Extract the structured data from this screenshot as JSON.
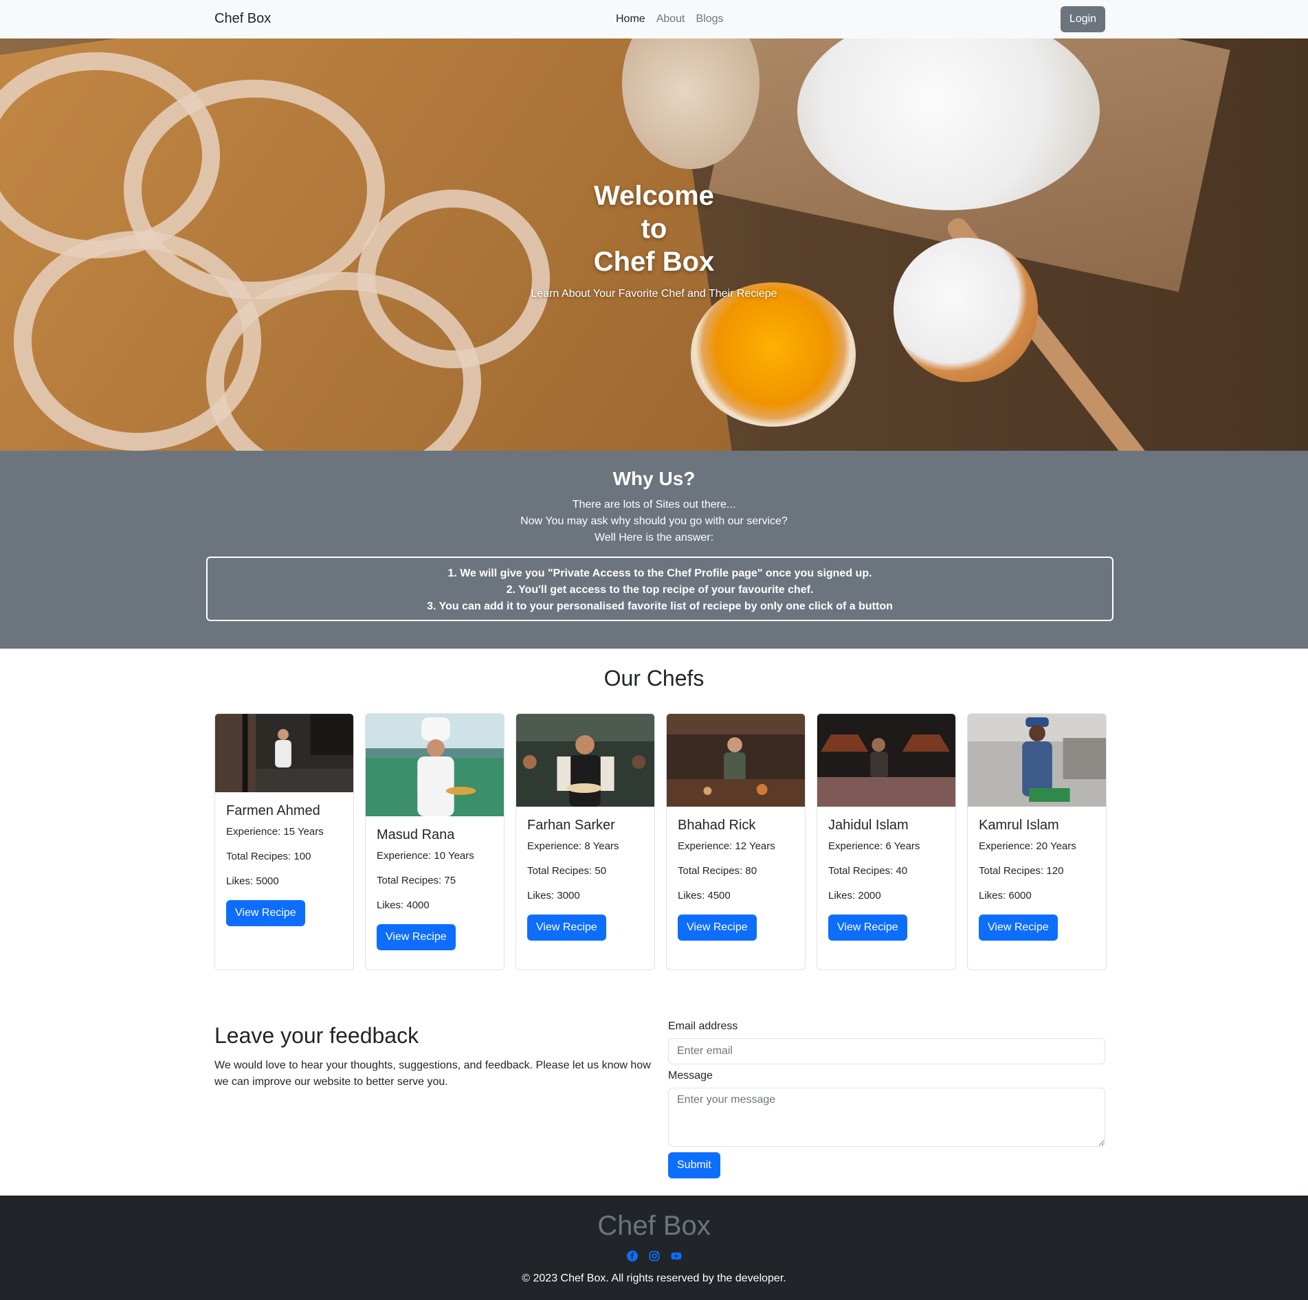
{
  "nav": {
    "brand": "Chef Box",
    "links": [
      {
        "label": "Home",
        "active": true
      },
      {
        "label": "About",
        "active": false
      },
      {
        "label": "Blogs",
        "active": false
      }
    ],
    "login_label": "Login"
  },
  "hero": {
    "title_line1": "Welcome",
    "title_line2": "to",
    "title_line3": "Chef Box",
    "subtitle": "Learn About Your Favorite Chef and Their Reciepe"
  },
  "why": {
    "title": "Why Us?",
    "lines": [
      "There are lots of Sites out there...",
      "Now You may ask why should you go with our service?",
      "Well Here is the answer:"
    ],
    "points": [
      "1. We will give you \"Private Access to the Chef Profile page\" once you signed up.",
      "2. You'll get access to the top recipe of your favourite chef.",
      "3. You can add it to your personalised favorite list of reciepe by only one click of a button"
    ]
  },
  "chefs": {
    "title": "Our Chefs",
    "button_label": "View Recipe",
    "items": [
      {
        "name": "Farmen Ahmed",
        "experience": "Experience: 15 Years",
        "recipes": "Total Recipes: 100",
        "likes": "Likes: 5000"
      },
      {
        "name": "Masud Rana",
        "experience": "Experience: 10 Years",
        "recipes": "Total Recipes: 75",
        "likes": "Likes: 4000"
      },
      {
        "name": "Farhan Sarker",
        "experience": "Experience: 8 Years",
        "recipes": "Total Recipes: 50",
        "likes": "Likes: 3000"
      },
      {
        "name": "Bhahad Rick",
        "experience": "Experience: 12 Years",
        "recipes": "Total Recipes: 80",
        "likes": "Likes: 4500"
      },
      {
        "name": "Jahidul Islam",
        "experience": "Experience: 6 Years",
        "recipes": "Total Recipes: 40",
        "likes": "Likes: 2000"
      },
      {
        "name": "Kamrul Islam",
        "experience": "Experience: 20 Years",
        "recipes": "Total Recipes: 120",
        "likes": "Likes: 6000"
      }
    ]
  },
  "feedback": {
    "title": "Leave your feedback",
    "description": "We would love to hear your thoughts, suggestions, and feedback. Please let us know how we can improve our website to better serve you.",
    "email_label": "Email address",
    "email_placeholder": "Enter email",
    "message_label": "Message",
    "message_placeholder": "Enter your message",
    "submit_label": "Submit"
  },
  "footer": {
    "brand": "Chef Box",
    "social_icons": [
      "facebook-icon",
      "instagram-icon",
      "youtube-icon"
    ],
    "copyright": "© 2023 Chef Box. All rights reserved by the developer."
  },
  "colors": {
    "primary": "#0d6efd",
    "secondary": "#6c757d",
    "dark": "#212529",
    "light": "#f8f9fa"
  }
}
